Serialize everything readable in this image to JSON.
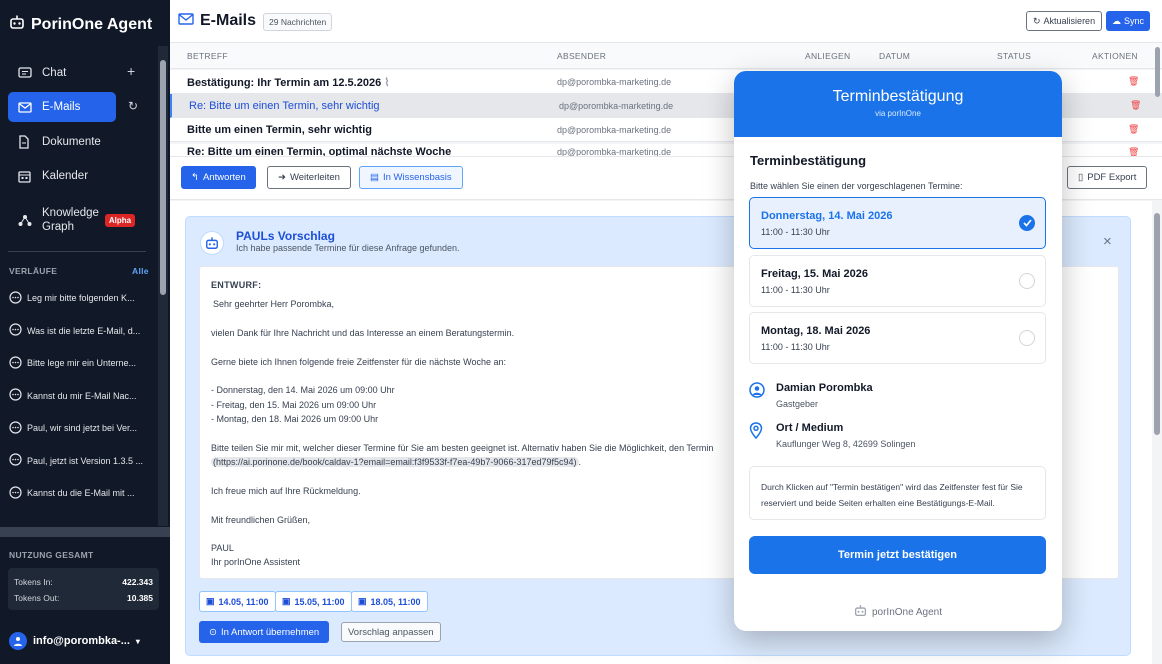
{
  "app": {
    "name": "PorinOne Agent"
  },
  "sidebar": {
    "nav": [
      {
        "label": "Chat"
      },
      {
        "label": "E-Mails"
      },
      {
        "label": "Dokumente"
      },
      {
        "label": "Kalender"
      },
      {
        "label": "Knowledge",
        "label2": "Graph",
        "badge": "Alpha"
      }
    ],
    "history_label": "VERLÄUFE",
    "history_all": "Alle",
    "history": [
      "Leg mir bitte folgenden K...",
      "Was ist die letzte E-Mail, d...",
      "Bitte lege mir ein Unterne...",
      "Kannst du mir E-Mail Nac...",
      "Paul, wir sind jetzt bei Ver...",
      "Paul, jetzt ist Version 1.3.5 ...",
      "Kannst du die E-Mail mit ..."
    ],
    "usage_label": "NUTZUNG GESAMT",
    "tokens_in_label": "Tokens In:",
    "tokens_in": "422.343",
    "tokens_out_label": "Tokens Out:",
    "tokens_out": "10.385",
    "user": "info@porombka-..."
  },
  "header": {
    "title": "E-Mails",
    "count": "29 Nachrichten",
    "refresh": "Aktualisieren",
    "sync": "Sync"
  },
  "table": {
    "columns": [
      "BETREFF",
      "ABSENDER",
      "ANLIEGEN",
      "DATUM",
      "STATUS",
      "AKTIONEN"
    ],
    "rows": [
      {
        "subject": "Bestätigung: Ihr Termin am 12.5.2026",
        "from": "dp@porombka-marketing.de"
      },
      {
        "subject": "Re: Bitte um einen Termin, sehr wichtig",
        "from": "dp@porombka-marketing.de"
      },
      {
        "subject": "Bitte um einen Termin, sehr wichtig",
        "from": "dp@porombka-marketing.de"
      },
      {
        "subject": "Re: Bitte um einen Termin, optimal nächste Woche",
        "from": "dp@porombka-marketing.de"
      }
    ]
  },
  "actions": {
    "reply": "Antworten",
    "forward": "Weiterleiten",
    "knowledge": "In Wissensbasis",
    "pdf": "PDF Export"
  },
  "suggestion": {
    "title": "PAULs Vorschlag",
    "subtitle": "Ich habe passende Termine für diese Anfrage gefunden.",
    "draft_label": "ENTWURF:",
    "lines": {
      "greeting": "Sehr geehrter Herr Porombka,",
      "p1": "vielen Dank für Ihre Nachricht und das Interesse an einem Beratungstermin.",
      "p2": "Gerne biete ich Ihnen folgende freie Zeitfenster für die nächste Woche an:",
      "o1": "- Donnerstag, den 14. Mai 2026 um 09:00 Uhr",
      "o2": "- Freitag, den 15. Mai 2026 um 09:00 Uhr",
      "o3": "- Montag, den 18. Mai 2026 um 09:00 Uhr",
      "p3": "Bitte teilen Sie mir mit, welcher dieser Termine für Sie am besten geeignet ist. Alternativ haben Sie die Möglichkeit, den Termin",
      "link": "(https://ai.porinone.de/book/caldav-1?email=email:f3f9533f-f7ea-49b7-9066-317ed79f5c94)",
      "link_end": ".",
      "p4": "Ich freue mich auf Ihre Rückmeldung.",
      "closing": "Mit freundlichen Grüßen,",
      "sig1": "PAUL",
      "sig2": "Ihr porInOne Assistent"
    },
    "slots": [
      "14.05, 11:00",
      "15.05, 11:00",
      "18.05, 11:00"
    ],
    "take": "In Antwort übernehmen",
    "adjust": "Vorschlag anpassen"
  },
  "modal": {
    "title": "Terminbestätigung",
    "via": "via porInOne",
    "heading": "Terminbestätigung",
    "prompt": "Bitte wählen Sie einen der vorgeschlagenen Termine:",
    "options": [
      {
        "date": "Donnerstag, 14. Mai 2026",
        "time": "11:00 - 11:30 Uhr",
        "selected": true
      },
      {
        "date": "Freitag, 15. Mai 2026",
        "time": "11:00 - 11:30 Uhr",
        "selected": false
      },
      {
        "date": "Montag, 18. Mai 2026",
        "time": "11:00 - 11:30 Uhr",
        "selected": false
      }
    ],
    "host_name": "Damian Porombka",
    "host_role": "Gastgeber",
    "place_label": "Ort / Medium",
    "place_addr": "Kauflunger Weg 8, 42699 Solingen",
    "note": "Durch Klicken auf \"Termin bestätigen\" wird das Zeitfenster fest für Sie reserviert und beide Seiten erhalten eine Bestätigungs-E-Mail.",
    "confirm": "Termin jetzt bestätigen",
    "footer": "porInOne Agent"
  },
  "colors": {
    "accent": "#2563eb",
    "modal_accent": "#1a73e8",
    "sidebar_bg": "#111827",
    "danger": "#ef4444",
    "alpha_badge": "#dc2626"
  }
}
